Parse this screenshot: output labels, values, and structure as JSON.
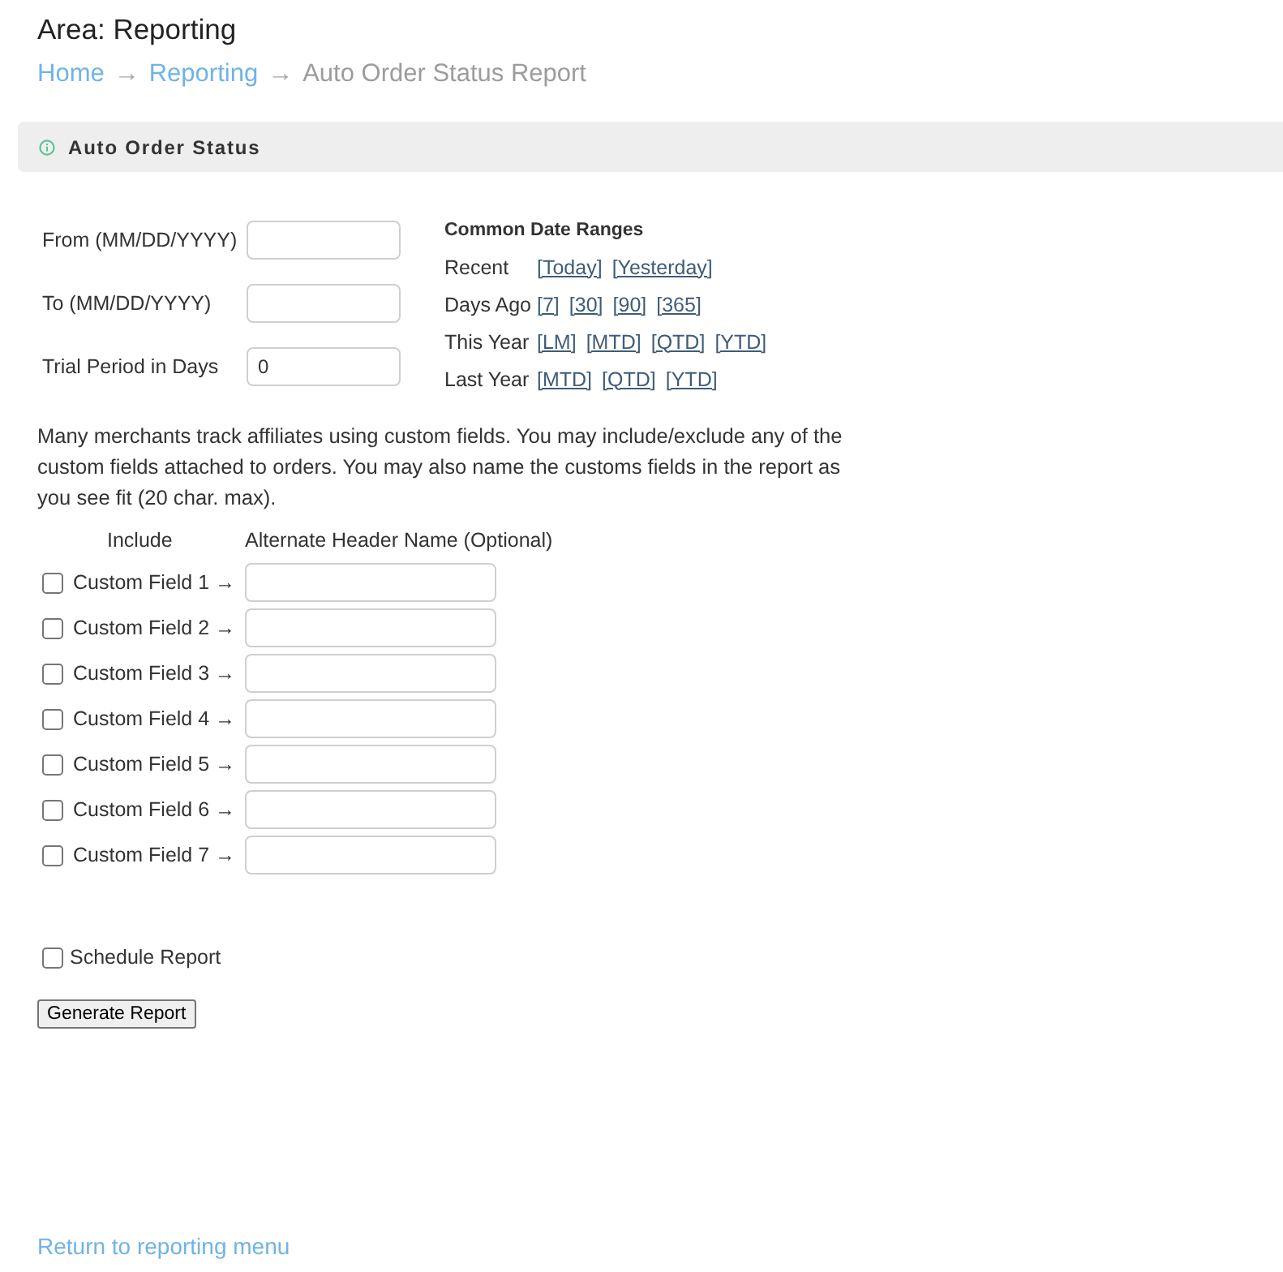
{
  "page": {
    "title": "Area: Reporting"
  },
  "breadcrumb": [
    {
      "label": "Home",
      "kind": "link"
    },
    {
      "label": "→",
      "kind": "separator"
    },
    {
      "label": "Reporting",
      "kind": "link"
    },
    {
      "label": "→",
      "kind": "separator"
    },
    {
      "label": "Auto Order Status Report",
      "kind": "current"
    }
  ],
  "panel": {
    "title": "Auto Order Status"
  },
  "date_fields": [
    {
      "label": "From (MM/DD/YYYY)"
    },
    {
      "label": "To (MM/DD/YYYY)"
    },
    {
      "label": "Trial Period in Days",
      "value": "0"
    }
  ],
  "common_date_ranges": {
    "title": "Common Date Ranges",
    "rows": [
      {
        "label": "Recent",
        "links": [
          "[Today]",
          "[Yesterday]"
        ]
      },
      {
        "label": "Days Ago",
        "links": [
          "[7]",
          "[30]",
          "[90]",
          "[365]"
        ]
      },
      {
        "label": "This Year",
        "links": [
          "[LM]",
          "[MTD]",
          "[QTD]",
          "[YTD]"
        ]
      },
      {
        "label": "Last Year",
        "links": [
          "[MTD]",
          "[QTD]",
          "[YTD]"
        ]
      }
    ]
  },
  "custom_fields": {
    "description": "Many merchants track affiliates using custom fields. You may include/exclude any of the custom fields attached to orders. You may also name the customs fields in the report as you see fit (20 char. max).",
    "columns": [
      "Include",
      "Alternate Header Name (Optional)"
    ],
    "rows": [
      {
        "label": "Custom Field 1 →",
        "checked": false
      },
      {
        "label": "Custom Field 2 →",
        "checked": false
      },
      {
        "label": "Custom Field 3 →",
        "checked": false
      },
      {
        "label": "Custom Field 4 →",
        "checked": false
      },
      {
        "label": "Custom Field 5 →",
        "checked": false
      },
      {
        "label": "Custom Field 6 →",
        "checked": false
      },
      {
        "label": "Custom Field 7 →",
        "checked": false
      }
    ]
  },
  "schedule": {
    "label": "Schedule Report",
    "checked": false
  },
  "generate_button": {
    "label": "Generate Report"
  },
  "return_link": {
    "label": "Return to reporting menu"
  }
}
